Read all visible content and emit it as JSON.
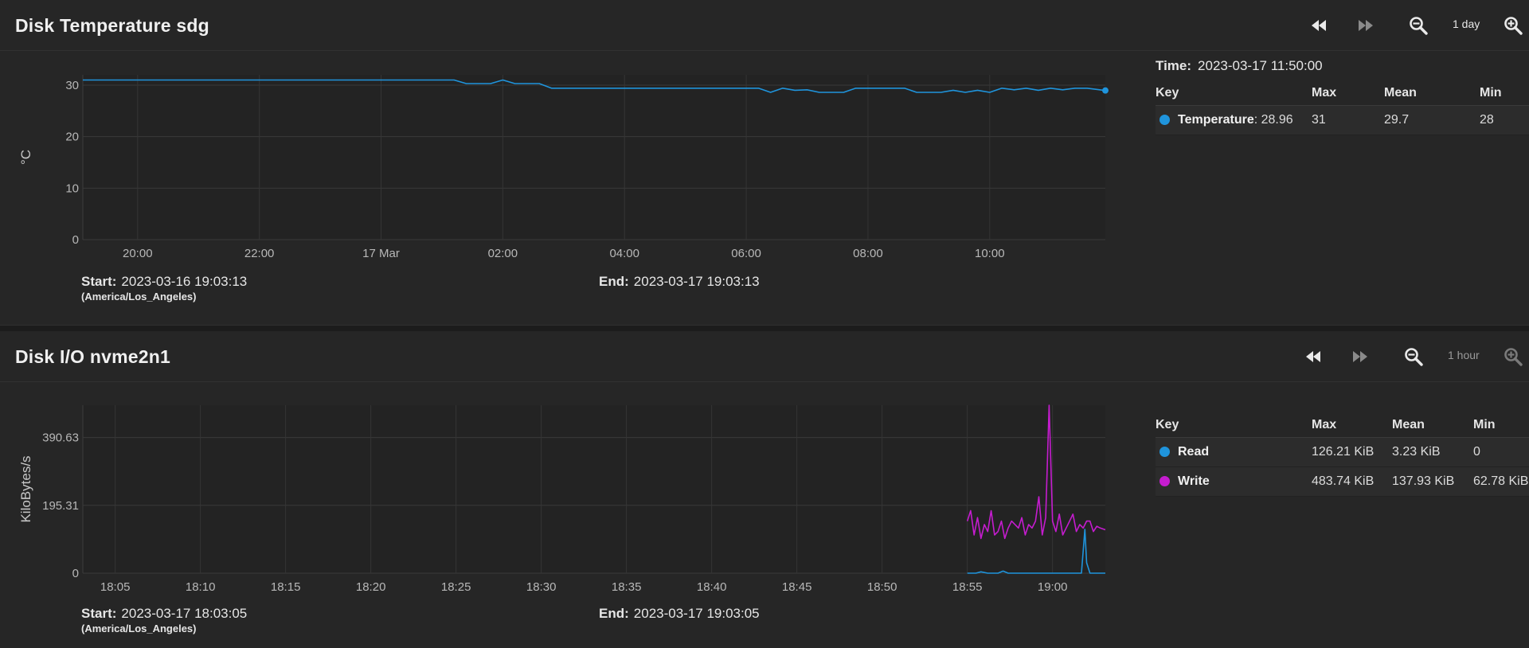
{
  "panels": [
    {
      "title": "Disk Temperature sdg",
      "zoom_label": "1 day",
      "time_label": "Time:",
      "time_value": "2023-03-17 11:50:00",
      "start_label": "Start:",
      "start_value": "2023-03-16 19:03:13",
      "timezone": "(America/Los_Angeles)",
      "end_label": "End:",
      "end_value": "2023-03-17 19:03:13",
      "legend": {
        "headers": [
          "Key",
          "Max",
          "Mean",
          "Min"
        ],
        "rows": [
          {
            "key": "Temperature",
            "current": ": 28.96",
            "max": "31",
            "mean": "29.7",
            "min": "28",
            "color": "#1f94dc"
          }
        ]
      }
    },
    {
      "title": "Disk I/O nvme2n1",
      "zoom_label": "1 hour",
      "start_label": "Start:",
      "start_value": "2023-03-17 18:03:05",
      "timezone": "(America/Los_Angeles)",
      "end_label": "End:",
      "end_value": "2023-03-17 19:03:05",
      "legend": {
        "headers": [
          "Key",
          "Max",
          "Mean",
          "Min"
        ],
        "rows": [
          {
            "key": "Read",
            "current": "",
            "max": "126.21 KiB",
            "mean": "3.23 KiB",
            "min": "0",
            "color": "#1f94dc"
          },
          {
            "key": "Write",
            "current": "",
            "max": "483.74 KiB",
            "mean": "137.93 KiB",
            "min": "62.78 KiB",
            "color": "#c51ccf"
          }
        ]
      }
    }
  ],
  "chart_data": [
    {
      "type": "line",
      "ylabel": "°C",
      "ylim": [
        0,
        32
      ],
      "yticks": [
        0,
        10,
        20,
        30
      ],
      "xticks": [
        "20:00",
        "22:00",
        "17 Mar",
        "02:00",
        "04:00",
        "06:00",
        "08:00",
        "10:00"
      ],
      "xtick_hours": [
        20,
        22,
        24,
        26,
        28,
        30,
        32,
        34
      ],
      "xlim_hours": [
        19.1,
        35.9
      ],
      "grid": true,
      "series": [
        {
          "name": "Temperature",
          "color": "#1f94dc",
          "x_hours": [
            19.1,
            25.2,
            25.4,
            25.8,
            26.0,
            26.2,
            26.6,
            26.8,
            30.2,
            30.4,
            30.6,
            30.8,
            31.0,
            31.2,
            31.4,
            31.6,
            31.8,
            32.0,
            32.2,
            32.6,
            32.8,
            33.0,
            33.2,
            33.4,
            33.6,
            33.8,
            34.0,
            34.2,
            34.4,
            34.6,
            34.8,
            35.0,
            35.2,
            35.4,
            35.6,
            35.9
          ],
          "values": [
            31,
            31,
            30.3,
            30.3,
            31,
            30.3,
            30.3,
            29.4,
            29.4,
            28.6,
            29.4,
            29,
            29.1,
            28.6,
            28.6,
            28.6,
            29.4,
            29.4,
            29.4,
            29.4,
            28.6,
            28.6,
            28.6,
            29,
            28.6,
            29,
            28.6,
            29.4,
            29.1,
            29.4,
            29.0,
            29.4,
            29.1,
            29.4,
            29.4,
            28.96
          ]
        }
      ]
    },
    {
      "type": "line",
      "ylabel": "KiloBytes/s",
      "ylim": [
        0,
        483.74
      ],
      "yticks": [
        0,
        195.31,
        390.63
      ],
      "yticklabels": [
        "0",
        "195.31",
        "390.63"
      ],
      "xticks": [
        "18:05",
        "18:10",
        "18:15",
        "18:20",
        "18:25",
        "18:30",
        "18:35",
        "18:40",
        "18:45",
        "18:50",
        "18:55",
        "19:00"
      ],
      "xtick_minutes": [
        5,
        10,
        15,
        20,
        25,
        30,
        35,
        40,
        45,
        50,
        55,
        60
      ],
      "xlim_minutes": [
        3.1,
        63.1
      ],
      "grid": true,
      "series": [
        {
          "name": "Read",
          "color": "#1f94dc",
          "x_minutes": [
            55.0,
            55.5,
            55.8,
            56.2,
            56.8,
            57.1,
            57.4,
            58.0,
            59.0,
            60.0,
            61.0,
            61.7,
            61.9,
            62.0,
            62.2,
            63.1
          ],
          "values": [
            0,
            0,
            4,
            0,
            0,
            6,
            0,
            0,
            0,
            0,
            0,
            0,
            126.21,
            30,
            0,
            0
          ]
        },
        {
          "name": "Write",
          "color": "#c51ccf",
          "x_minutes": [
            55.0,
            55.2,
            55.4,
            55.6,
            55.8,
            56.0,
            56.2,
            56.4,
            56.6,
            56.8,
            57.0,
            57.2,
            57.4,
            57.6,
            57.8,
            58.0,
            58.2,
            58.4,
            58.6,
            58.8,
            59.0,
            59.2,
            59.4,
            59.6,
            59.8,
            60.0,
            60.2,
            60.4,
            60.6,
            60.8,
            61.0,
            61.2,
            61.4,
            61.6,
            61.8,
            62.0,
            62.2,
            62.4,
            62.6,
            62.8,
            63.1
          ],
          "values": [
            150,
            180,
            110,
            160,
            100,
            140,
            120,
            180,
            110,
            120,
            150,
            100,
            130,
            150,
            140,
            130,
            160,
            110,
            140,
            130,
            150,
            220,
            110,
            160,
            483.74,
            150,
            120,
            170,
            110,
            130,
            150,
            170,
            120,
            140,
            130,
            150,
            150,
            120,
            135,
            130,
            125
          ]
        }
      ]
    }
  ]
}
